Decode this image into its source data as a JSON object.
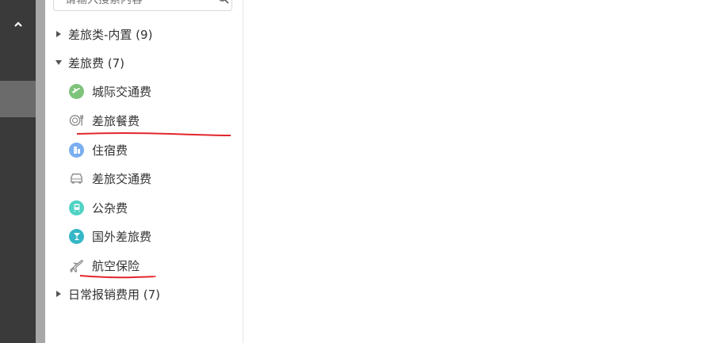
{
  "search": {
    "placeholder": "请输入搜索内容"
  },
  "tree": {
    "groups": [
      {
        "label": "差旅类-内置 (9)",
        "expanded": false
      },
      {
        "label": "差旅费 (7)",
        "expanded": true
      },
      {
        "label": "日常报销费用 (7)",
        "expanded": false
      }
    ],
    "items": [
      {
        "label": "城际交通费",
        "icon": "plane-circle-icon",
        "color": "#7dc37a"
      },
      {
        "label": "差旅餐费",
        "icon": "dining-icon",
        "color": "#888888"
      },
      {
        "label": "住宿费",
        "icon": "building-icon",
        "color": "#7aaef0"
      },
      {
        "label": "差旅交通费",
        "icon": "car-icon",
        "color": "#888888"
      },
      {
        "label": "公杂费",
        "icon": "train-icon",
        "color": "#4fd2c4"
      },
      {
        "label": "国外差旅费",
        "icon": "cocktail-icon",
        "color": "#35b7c7"
      },
      {
        "label": "航空保险",
        "icon": "airplane-icon",
        "color": "#888888"
      }
    ]
  },
  "annotation_color": "#e3262d"
}
